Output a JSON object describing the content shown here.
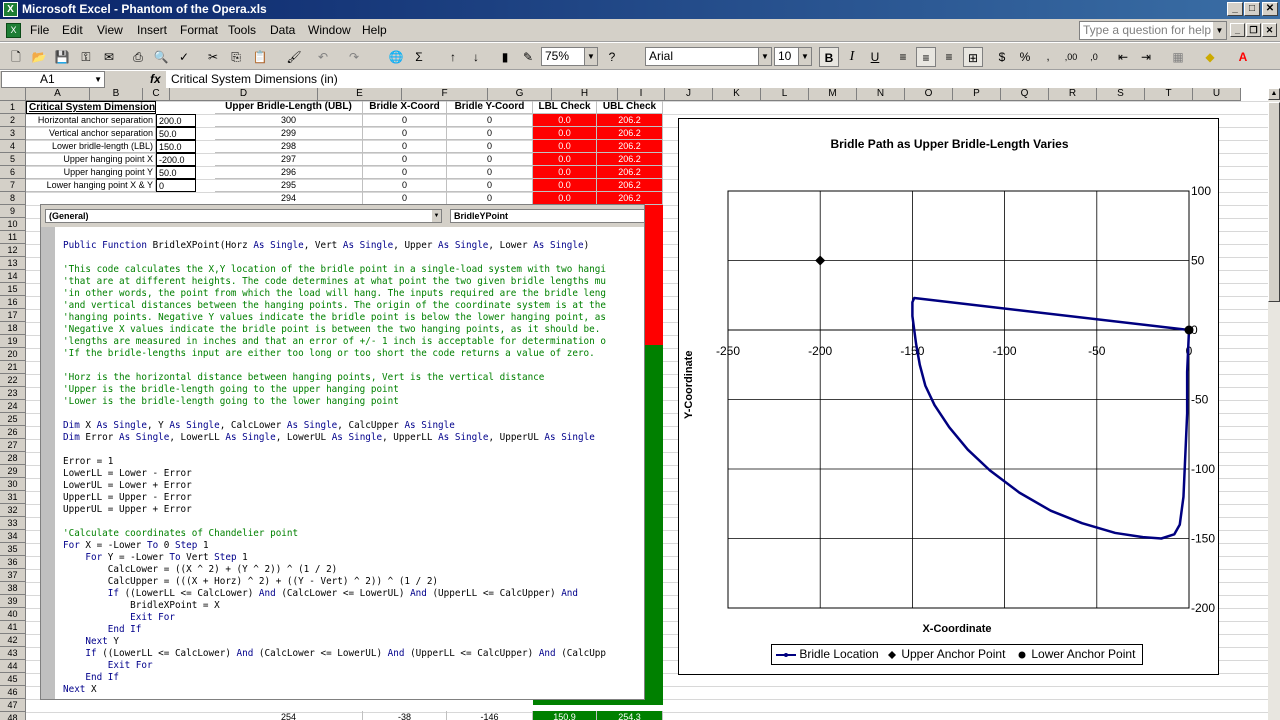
{
  "window": {
    "title": "Microsoft Excel - Phantom of the Opera.xls",
    "min": "_",
    "max": "□",
    "close": "✕"
  },
  "menu": [
    "File",
    "Edit",
    "View",
    "Insert",
    "Format",
    "Tools",
    "Data",
    "Window",
    "Help"
  ],
  "help_placeholder": "Type a question for help",
  "toolbar": {
    "zoom": "75%",
    "font": "Arial",
    "size": "10",
    "bold": "B",
    "italic": "I",
    "underline": "U",
    "currency": "$",
    "percent": "%",
    "inc_decimal": ",00",
    "dec_decimal": ",0"
  },
  "formula_bar": {
    "name_box": "A1",
    "fx": "fx",
    "formula": "Critical System Dimensions (in)"
  },
  "columns": [
    "A",
    "B",
    "C",
    "D",
    "E",
    "F",
    "G",
    "H",
    "I",
    "J",
    "K",
    "L",
    "M",
    "N",
    "O",
    "P",
    "Q",
    "R",
    "S",
    "T",
    "U"
  ],
  "rows": [
    "1",
    "2",
    "3",
    "4",
    "5",
    "6",
    "7",
    "8",
    "9",
    "10",
    "11",
    "12",
    "13",
    "14",
    "15",
    "16",
    "17",
    "18",
    "19",
    "20",
    "21",
    "22",
    "23",
    "24",
    "25",
    "26",
    "27",
    "28",
    "29",
    "30",
    "31",
    "32",
    "33",
    "34",
    "35",
    "36",
    "37",
    "38",
    "39",
    "40",
    "41",
    "42",
    "43",
    "44",
    "45",
    "46",
    "47",
    "48"
  ],
  "sheet": {
    "headers": {
      "a1": "Critical System Dimensions (in)",
      "d": "Upper Bridle-Length (UBL)",
      "e": "Bridle X-Coord",
      "f": "Bridle Y-Coord",
      "g": "LBL Check",
      "h": "UBL Check"
    },
    "dimensions": [
      {
        "label": "Horizontal anchor separation",
        "value": "200.0"
      },
      {
        "label": "Vertical anchor separation",
        "value": "50.0"
      },
      {
        "label": "Lower bridle-length (LBL)",
        "value": "150.0"
      },
      {
        "label": "Upper hanging point X",
        "value": "-200.0"
      },
      {
        "label": "Upper hanging point Y",
        "value": "50.0"
      },
      {
        "label": "Lower hanging point X & Y",
        "value": "0"
      }
    ],
    "data_rows": [
      {
        "d": "300",
        "e": "0",
        "f": "0",
        "g": "0.0",
        "h": "206.2"
      },
      {
        "d": "299",
        "e": "0",
        "f": "0",
        "g": "0.0",
        "h": "206.2"
      },
      {
        "d": "298",
        "e": "0",
        "f": "0",
        "g": "0.0",
        "h": "206.2"
      },
      {
        "d": "297",
        "e": "0",
        "f": "0",
        "g": "0.0",
        "h": "206.2"
      },
      {
        "d": "296",
        "e": "0",
        "f": "0",
        "g": "0.0",
        "h": "206.2"
      },
      {
        "d": "295",
        "e": "0",
        "f": "0",
        "g": "0.0",
        "h": "206.2"
      },
      {
        "d": "294",
        "e": "0",
        "f": "0",
        "g": "0.0",
        "h": "206.2"
      }
    ],
    "last_row": {
      "d": "254",
      "e": "-38",
      "f": "-146",
      "g": "150.9",
      "h": "254.3"
    }
  },
  "vba": {
    "object_dropdown": "(General)",
    "proc_dropdown": "BridleYPoint",
    "code": [
      [
        [
          "kw",
          "Public Function "
        ],
        [
          "tx",
          "BridleXPoint(Horz "
        ],
        [
          "kw",
          "As Single"
        ],
        [
          "tx",
          ", Vert "
        ],
        [
          "kw",
          "As Single"
        ],
        [
          "tx",
          ", Upper "
        ],
        [
          "kw",
          "As Single"
        ],
        [
          "tx",
          ", Lower "
        ],
        [
          "kw",
          "As Single"
        ],
        [
          "tx",
          ")"
        ]
      ],
      [],
      [
        [
          "cm",
          "'This code calculates the X,Y location of the bridle point in a single-load system with two hangi"
        ]
      ],
      [
        [
          "cm",
          "'that are at different heights. The code determines at what point the two given bridle lengths mu"
        ]
      ],
      [
        [
          "cm",
          "'in other words, the point from which the load will hang. The inputs required are the bridle leng"
        ]
      ],
      [
        [
          "cm",
          "'and vertical distances between the hanging points. The origin of the coordinate system is at the"
        ]
      ],
      [
        [
          "cm",
          "'hanging points. Negative Y values indicate the bridle point is below the lower hanging point, as"
        ]
      ],
      [
        [
          "cm",
          "'Negative X values indicate the bridle point is between the two hanging points, as it should be."
        ]
      ],
      [
        [
          "cm",
          "'lengths are measured in inches and that an error of +/- 1 inch is acceptable for determination o"
        ]
      ],
      [
        [
          "cm",
          "'If the bridle-lengths input are either too long or too short the code returns a value of zero."
        ]
      ],
      [],
      [
        [
          "cm",
          "'Horz is the horizontal distance between hanging points, Vert is the vertical distance"
        ]
      ],
      [
        [
          "cm",
          "'Upper is the bridle-length going to the upper hanging point"
        ]
      ],
      [
        [
          "cm",
          "'Lower is the bridle-length going to the lower hanging point"
        ]
      ],
      [],
      [
        [
          "kw",
          "Dim "
        ],
        [
          "tx",
          "X "
        ],
        [
          "kw",
          "As Single"
        ],
        [
          "tx",
          ", Y "
        ],
        [
          "kw",
          "As Single"
        ],
        [
          "tx",
          ", CalcLower "
        ],
        [
          "kw",
          "As Single"
        ],
        [
          "tx",
          ", CalcUpper "
        ],
        [
          "kw",
          "As Single"
        ]
      ],
      [
        [
          "kw",
          "Dim "
        ],
        [
          "tx",
          "Error "
        ],
        [
          "kw",
          "As Single"
        ],
        [
          "tx",
          ", LowerLL "
        ],
        [
          "kw",
          "As Single"
        ],
        [
          "tx",
          ", LowerUL "
        ],
        [
          "kw",
          "As Single"
        ],
        [
          "tx",
          ", UpperLL "
        ],
        [
          "kw",
          "As Single"
        ],
        [
          "tx",
          ", UpperUL "
        ],
        [
          "kw",
          "As Single"
        ]
      ],
      [],
      [
        [
          "tx",
          "Error = 1"
        ]
      ],
      [
        [
          "tx",
          "LowerLL = Lower - Error"
        ]
      ],
      [
        [
          "tx",
          "LowerUL = Lower + Error"
        ]
      ],
      [
        [
          "tx",
          "UpperLL = Upper - Error"
        ]
      ],
      [
        [
          "tx",
          "UpperUL = Upper + Error"
        ]
      ],
      [],
      [
        [
          "cm",
          "'Calculate coordinates of Chandelier point"
        ]
      ],
      [
        [
          "kw",
          "For "
        ],
        [
          "tx",
          "X = -Lower "
        ],
        [
          "kw",
          "To "
        ],
        [
          "tx",
          "0 "
        ],
        [
          "kw",
          "Step "
        ],
        [
          "tx",
          "1"
        ]
      ],
      [
        [
          "tx",
          "    "
        ],
        [
          "kw",
          "For "
        ],
        [
          "tx",
          "Y = -Lower "
        ],
        [
          "kw",
          "To "
        ],
        [
          "tx",
          "Vert "
        ],
        [
          "kw",
          "Step "
        ],
        [
          "tx",
          "1"
        ]
      ],
      [
        [
          "tx",
          "        CalcLower = ((X ^ 2) + (Y ^ 2)) ^ (1 / 2)"
        ]
      ],
      [
        [
          "tx",
          "        CalcUpper = (((X + Horz) ^ 2) + ((Y - Vert) ^ 2)) ^ (1 / 2)"
        ]
      ],
      [
        [
          "tx",
          "        "
        ],
        [
          "kw",
          "If "
        ],
        [
          "tx",
          "((LowerLL <= CalcLower) "
        ],
        [
          "kw",
          "And "
        ],
        [
          "tx",
          "(CalcLower <= LowerUL) "
        ],
        [
          "kw",
          "And "
        ],
        [
          "tx",
          "(UpperLL <= CalcUpper) "
        ],
        [
          "kw",
          "And"
        ]
      ],
      [
        [
          "tx",
          "            BridleXPoint = X"
        ]
      ],
      [
        [
          "tx",
          "            "
        ],
        [
          "kw",
          "Exit For"
        ]
      ],
      [
        [
          "tx",
          "        "
        ],
        [
          "kw",
          "End If"
        ]
      ],
      [
        [
          "tx",
          "    "
        ],
        [
          "kw",
          "Next "
        ],
        [
          "tx",
          "Y"
        ]
      ],
      [
        [
          "tx",
          "    "
        ],
        [
          "kw",
          "If "
        ],
        [
          "tx",
          "((LowerLL <= CalcLower) "
        ],
        [
          "kw",
          "And "
        ],
        [
          "tx",
          "(CalcLower <= LowerUL) "
        ],
        [
          "kw",
          "And "
        ],
        [
          "tx",
          "(UpperLL <= CalcUpper) "
        ],
        [
          "kw",
          "And "
        ],
        [
          "tx",
          "(CalcUpp"
        ]
      ],
      [
        [
          "tx",
          "        "
        ],
        [
          "kw",
          "Exit For"
        ]
      ],
      [
        [
          "tx",
          "    "
        ],
        [
          "kw",
          "End If"
        ]
      ],
      [
        [
          "kw",
          "Next "
        ],
        [
          "tx",
          "X"
        ]
      ]
    ]
  },
  "chart_data": {
    "type": "scatter",
    "title": "Bridle Path as Upper Bridle-Length Varies",
    "xlabel": "X-Coordinate",
    "ylabel": "Y-Coordinate",
    "xlim": [
      -250,
      0
    ],
    "ylim": [
      -200,
      100
    ],
    "xticks": [
      -250,
      -200,
      -150,
      -100,
      -50,
      0
    ],
    "yticks": [
      100,
      50,
      0,
      -50,
      -100,
      -150,
      -200
    ],
    "grid": true,
    "legend_position": "bottom",
    "series": [
      {
        "name": "Bridle Location",
        "style": "line",
        "color": "#000080",
        "x": [
          0,
          -1,
          -1,
          -2,
          -3,
          -5,
          -8,
          -15,
          -25,
          -40,
          -58,
          -75,
          -92,
          -108,
          -120,
          -130,
          -138,
          -143,
          -146,
          -148,
          -149,
          -150,
          -150,
          -149,
          0
        ],
        "y": [
          0,
          -30,
          -60,
          -90,
          -120,
          -140,
          -147,
          -150,
          -149,
          -146,
          -139,
          -130,
          -117,
          -101,
          -86,
          -70,
          -54,
          -40,
          -25,
          -10,
          0,
          10,
          20,
          23,
          0
        ]
      },
      {
        "name": "Upper Anchor Point",
        "style": "diamond",
        "color": "#000000",
        "x": [
          -200
        ],
        "y": [
          50
        ]
      },
      {
        "name": "Lower Anchor Point",
        "style": "circle",
        "color": "#000000",
        "x": [
          0
        ],
        "y": [
          0
        ]
      }
    ]
  }
}
